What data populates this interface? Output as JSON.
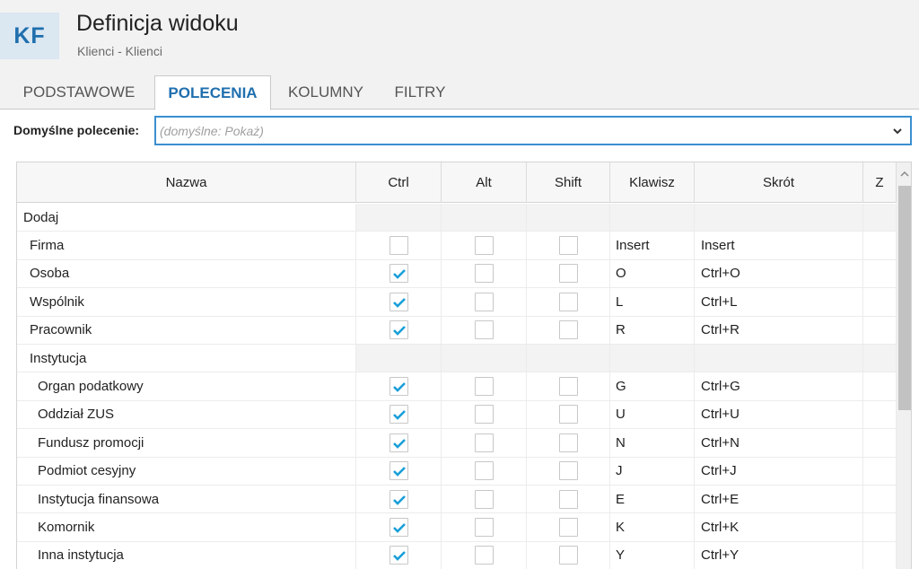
{
  "header": {
    "logo_text": "KF",
    "title": "Definicja widoku",
    "subtitle": "Klienci - Klienci"
  },
  "tabs": [
    {
      "label": "PODSTAWOWE",
      "active": false
    },
    {
      "label": "POLECENIA",
      "active": true
    },
    {
      "label": "KOLUMNY",
      "active": false
    },
    {
      "label": "FILTRY",
      "active": false
    }
  ],
  "default_command": {
    "label": "Domyślne polecenie:",
    "value": "",
    "placeholder": "(domyślne: Pokaż)"
  },
  "grid": {
    "columns": [
      "Nazwa",
      "Ctrl",
      "Alt",
      "Shift",
      "Klawisz",
      "Skrót",
      "Z"
    ],
    "rows": [
      {
        "name": "Dodaj",
        "level": 0,
        "group": true
      },
      {
        "name": "Firma",
        "level": 1,
        "ctrl": false,
        "alt": false,
        "shift": false,
        "key": "Insert",
        "shortcut": "Insert"
      },
      {
        "name": "Osoba",
        "level": 1,
        "ctrl": true,
        "alt": false,
        "shift": false,
        "key": "O",
        "shortcut": "Ctrl+O"
      },
      {
        "name": "Wspólnik",
        "level": 1,
        "ctrl": true,
        "alt": false,
        "shift": false,
        "key": "L",
        "shortcut": "Ctrl+L"
      },
      {
        "name": "Pracownik",
        "level": 1,
        "ctrl": true,
        "alt": false,
        "shift": false,
        "key": "R",
        "shortcut": "Ctrl+R"
      },
      {
        "name": "Instytucja",
        "level": 1,
        "group": true
      },
      {
        "name": "Organ podatkowy",
        "level": 2,
        "ctrl": true,
        "alt": false,
        "shift": false,
        "key": "G",
        "shortcut": "Ctrl+G"
      },
      {
        "name": "Oddział ZUS",
        "level": 2,
        "ctrl": true,
        "alt": false,
        "shift": false,
        "key": "U",
        "shortcut": "Ctrl+U"
      },
      {
        "name": "Fundusz promocji",
        "level": 2,
        "ctrl": true,
        "alt": false,
        "shift": false,
        "key": "N",
        "shortcut": "Ctrl+N"
      },
      {
        "name": "Podmiot cesyjny",
        "level": 2,
        "ctrl": true,
        "alt": false,
        "shift": false,
        "key": "J",
        "shortcut": "Ctrl+J"
      },
      {
        "name": "Instytucja finansowa",
        "level": 2,
        "ctrl": true,
        "alt": false,
        "shift": false,
        "key": "E",
        "shortcut": "Ctrl+E"
      },
      {
        "name": "Komornik",
        "level": 2,
        "ctrl": true,
        "alt": false,
        "shift": false,
        "key": "K",
        "shortcut": "Ctrl+K"
      },
      {
        "name": "Inna instytucja",
        "level": 2,
        "ctrl": true,
        "alt": false,
        "shift": false,
        "key": "Y",
        "shortcut": "Ctrl+Y"
      }
    ]
  },
  "colors": {
    "accent": "#1f6fae",
    "checkmark": "#1a9fd9",
    "input_border": "#3a8fd0"
  }
}
